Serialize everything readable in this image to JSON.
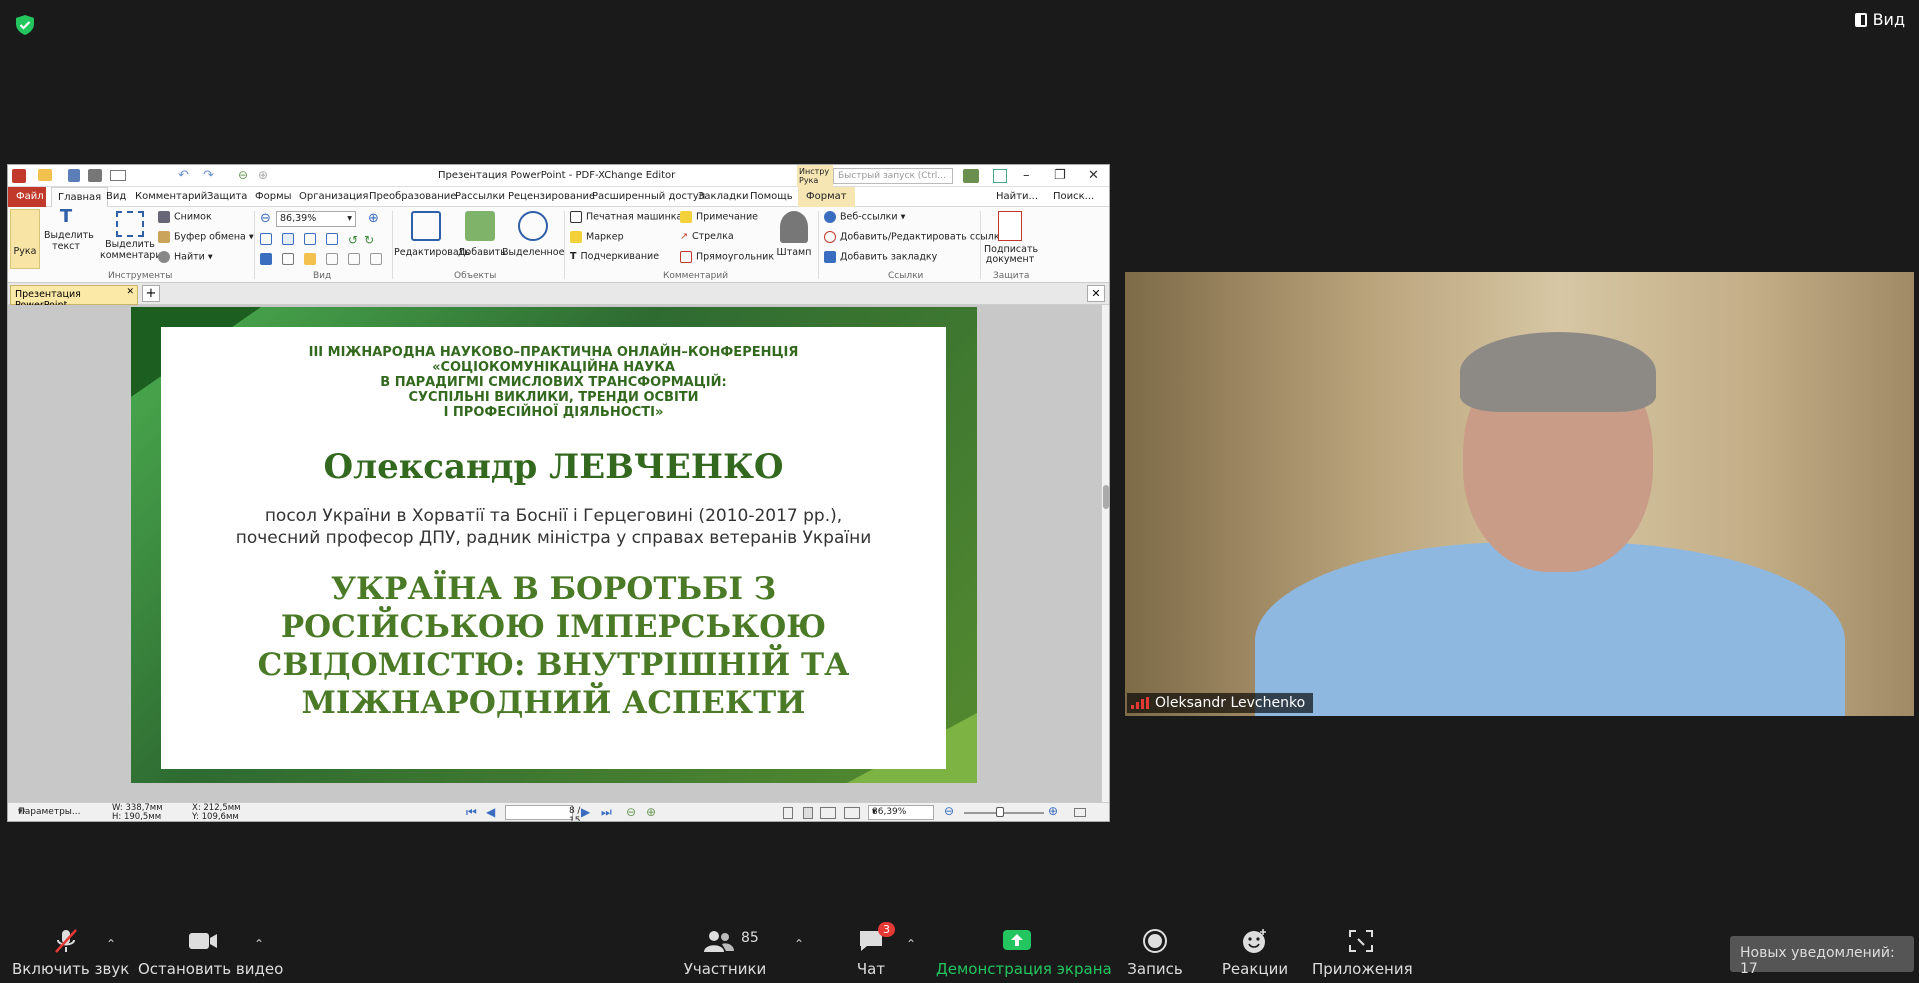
{
  "top": {
    "view_label": "Вид"
  },
  "pdf": {
    "title": "Презентация PowerPoint - PDF-XChange Editor",
    "quick_search_placeholder": "Быстрый запуск (Ctrl...",
    "instr_label": "Инстру Рука",
    "menu": [
      "Файл",
      "Главная",
      "Вид",
      "Комментарий",
      "Защита",
      "Формы",
      "Организация",
      "Преобразование",
      "Рассылки",
      "Рецензирование",
      "Расширенный доступ",
      "Закладки",
      "Помощь",
      "Формат"
    ],
    "menu_right": [
      "Найти...",
      "Поиск..."
    ],
    "ribbon": {
      "hand": "Рука",
      "select_text": "Выделить текст",
      "select_comments": "Выделить комментарии",
      "snapshot": "Снимок",
      "clipboard": "Буфер обмена",
      "find": "Найти",
      "group_tools": "Инструменты",
      "zoom": "86,39%",
      "group_view": "Вид",
      "edit": "Редактировать",
      "add": "Добавить",
      "selected": "Выделенное",
      "group_objects": "Объекты",
      "typewriter": "Печатная машинка",
      "note": "Примечание",
      "marker": "Маркер",
      "arrow": "Стрелка",
      "underline": "Подчеркивание",
      "rectangle": "Прямоугольник",
      "stamp": "Штамп",
      "group_comments": "Комментарий",
      "weblinks": "Веб-ссылки",
      "add_edit_links": "Добавить/Редактировать ссылки",
      "add_bookmark": "Добавить закладку",
      "group_links": "Ссылки",
      "sign_doc": "Подписать документ",
      "group_protect": "Защита"
    },
    "tab_label": "Презентация PowerPoint",
    "status": {
      "params": "Параметры...",
      "w": "W: 338,7мм",
      "h": "H: 190,5мм",
      "x": "X: 212,5мм",
      "y": "Y: 109,6мм",
      "page": "8",
      "page_total": "/ 15",
      "zoom": "86,39%"
    }
  },
  "slide": {
    "conf_lines": [
      "III МІЖНАРОДНА НАУКОВО–ПРАКТИЧНА ОНЛАЙН–КОНФЕРЕНЦІЯ",
      "«СОЦІОКОМУНІКАЦІЙНА НАУКА",
      "В ПАРАДИГМІ СМИСЛОВИХ ТРАНСФОРМАЦІЙ:",
      "СУСПІЛЬНІ ВИКЛИКИ, ТРЕНДИ ОСВІТИ",
      "І ПРОФЕСІЙНОЇ ДІЯЛЬНОСТІ»"
    ],
    "name": "Олександр ЛЕВЧЕНКО",
    "role_lines": [
      "посол України в Хорватії та Боснії і Герцеговині (2010-2017 рр.),",
      "почесний професор ДПУ, радник міністра у справах ветеранів України"
    ],
    "topic_lines": [
      "УКРАЇНА В БОРОТЬБІ З",
      "РОСІЙСЬКОЮ ІМПЕРСЬКОЮ",
      "СВІДОМІСТЮ: ВНУТРІШНІЙ ТА",
      "МІЖНАРОДНИЙ АСПЕКТИ"
    ]
  },
  "video": {
    "participant_name": "Oleksandr Levchenko"
  },
  "toolbar": {
    "unmute": "Включить звук",
    "stop_video": "Остановить видео",
    "participants": "Участники",
    "participants_count": "85",
    "chat": "Чат",
    "chat_badge": "3",
    "share": "Демонстрация экрана",
    "record": "Запись",
    "reactions": "Реакции",
    "apps": "Приложения",
    "notifications": "Новых уведомлений: 17"
  },
  "colors": {
    "share_green": "#22c55e",
    "badge_red": "#e53935",
    "accent_green": "#33691e"
  }
}
